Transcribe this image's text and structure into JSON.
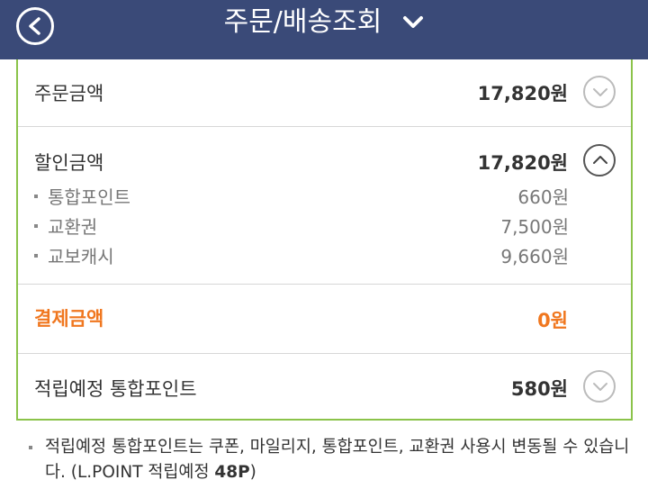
{
  "header": {
    "title": "주문/배송조회",
    "back_icon": "chevron-left-circle-icon",
    "dropdown_icon": "chevron-down-icon",
    "background_color": "#3a4a78"
  },
  "summary": {
    "order_amount": {
      "label": "주문금액",
      "value": "17,820원"
    },
    "discount_amount": {
      "label": "할인금액",
      "value": "17,820원",
      "items": [
        {
          "label": "통합포인트",
          "value": "660원"
        },
        {
          "label": "교환권",
          "value": "7,500원"
        },
        {
          "label": "교보캐시",
          "value": "9,660원"
        }
      ]
    },
    "payment_amount": {
      "label": "결제금액",
      "value": "0원",
      "color": "#f0771f"
    },
    "expected_points": {
      "label": "적립예정 통합포인트",
      "value": "580원"
    }
  },
  "note": {
    "text": "적립예정 통합포인트는 쿠폰, 마일리지, 통합포인트, 교환권 사용시 변동될 수 있습니다. (L.POINT 적립예정 ",
    "strong": "48P",
    "suffix": ")"
  },
  "colors": {
    "panel_border": "#8bc34a",
    "accent": "#f0771f"
  }
}
